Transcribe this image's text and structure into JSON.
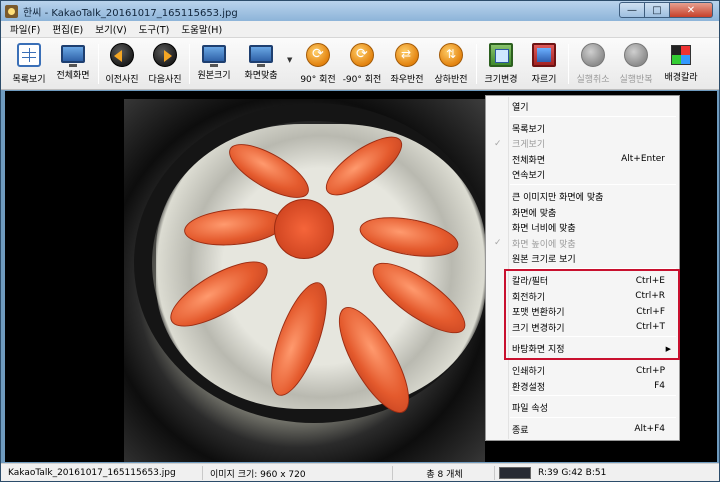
{
  "window": {
    "title": "한씨 - KakaoTalk_20161017_165115653.jpg",
    "controls": {
      "minimize": "—",
      "maximize": "□",
      "close": "✕"
    }
  },
  "menubar": [
    "파일(F)",
    "편집(E)",
    "보기(V)",
    "도구(T)",
    "도움말(H)"
  ],
  "toolbar": {
    "buttons": [
      {
        "label": "목록보기",
        "icon": "grid-icon"
      },
      {
        "label": "전체화면",
        "icon": "monitor-icon"
      },
      {
        "label": "이전사진",
        "icon": "arrow-left-icon"
      },
      {
        "label": "다음사진",
        "icon": "arrow-right-icon"
      },
      {
        "label": "원본크기",
        "icon": "monitor-icon"
      },
      {
        "label": "화면맞춤",
        "icon": "monitor-icon"
      },
      {
        "label": "90° 회전",
        "icon": "rotate-right-icon"
      },
      {
        "label": "-90° 회전",
        "icon": "rotate-left-icon"
      },
      {
        "label": "좌우반전",
        "icon": "flip-horizontal-icon"
      },
      {
        "label": "상하반전",
        "icon": "flip-vertical-icon"
      },
      {
        "label": "크기변경",
        "icon": "resize-icon"
      },
      {
        "label": "자르기",
        "icon": "crop-icon"
      },
      {
        "label": "실행취소",
        "icon": "undo-icon",
        "disabled": true
      },
      {
        "label": "실행반복",
        "icon": "redo-icon",
        "disabled": true
      },
      {
        "label": "배경칼라",
        "icon": "palette-icon"
      }
    ],
    "dropdown_arrow": "▼"
  },
  "context_menu": {
    "items": [
      {
        "label": "열기"
      },
      {
        "separator": true
      },
      {
        "label": "목록보기"
      },
      {
        "label": "크게보기",
        "checked": true,
        "disabled": true
      },
      {
        "label": "전체화면",
        "shortcut": "Alt+Enter"
      },
      {
        "label": "연속보기"
      },
      {
        "separator": true
      },
      {
        "label": "큰 이미지만 화면에 맞춤"
      },
      {
        "label": "화면에 맞춤"
      },
      {
        "label": "화면 너비에 맞춤"
      },
      {
        "label": "화면 높이에 맞춤",
        "checked": true,
        "disabled": true
      },
      {
        "label": "원본 크기로 보기"
      },
      {
        "separator": true
      },
      {
        "label": "칼라/필터",
        "shortcut": "Ctrl+E"
      },
      {
        "label": "회전하기",
        "shortcut": "Ctrl+R"
      },
      {
        "label": "포맷 변환하기",
        "shortcut": "Ctrl+F"
      },
      {
        "label": "크기 변경하기",
        "shortcut": "Ctrl+T"
      },
      {
        "separator": true
      },
      {
        "label": "바탕화면 지정",
        "submenu": true
      },
      {
        "separator": true
      },
      {
        "label": "인쇄하기",
        "shortcut": "Ctrl+P"
      },
      {
        "label": "환경설정",
        "shortcut": "F4"
      },
      {
        "separator": true
      },
      {
        "label": "파일 속성"
      },
      {
        "separator": true
      },
      {
        "label": "종료",
        "shortcut": "Alt+F4"
      }
    ],
    "check_glyph": "✓",
    "submenu_glyph": "▶"
  },
  "statusbar": {
    "filename": "KakaoTalk_20161017_165115653.jpg",
    "image_size": "이미지 크기: 960 x 720",
    "count": "총 8 개체",
    "pixel_color": "R:39 G:42 B:51",
    "swatch_color": "#272a33"
  },
  "colors": {
    "highlight_box": "#c8102e",
    "menu_background": "#f5f5f5"
  }
}
